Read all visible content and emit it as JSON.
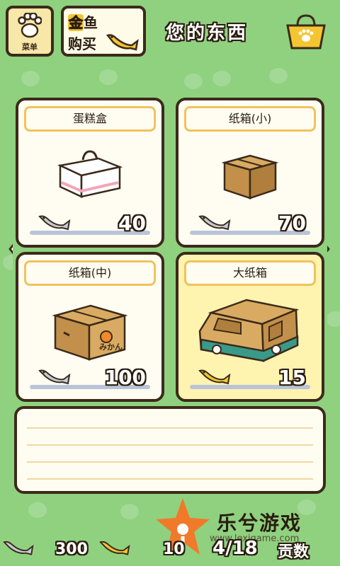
{
  "header": {
    "menu_label": "菜单",
    "gold_line1_highlight": "金",
    "gold_line1_rest": "鱼",
    "gold_line2": "购买",
    "title": "您的东西"
  },
  "store": {
    "items": [
      {
        "name": "蛋糕盒",
        "price": "40",
        "selected": false
      },
      {
        "name": "纸箱(小)",
        "price": "70",
        "selected": false
      },
      {
        "name": "纸箱(中)",
        "price": "100",
        "selected": false
      },
      {
        "name": "大纸箱",
        "price": "15",
        "selected": true
      }
    ]
  },
  "crate_label": "みかん",
  "footer": {
    "silver_fish": "300",
    "gold_fish": "10",
    "page_indicator": "4/18",
    "tribute_label": "贡数"
  },
  "watermark": {
    "brand": "乐兮游戏",
    "url": "www.lexigame.com"
  },
  "colors": {
    "background": "#8fd17f",
    "card_border": "#3b2a1a",
    "namebar_border": "#f1c25c",
    "selected_card": "#fff3b0"
  }
}
